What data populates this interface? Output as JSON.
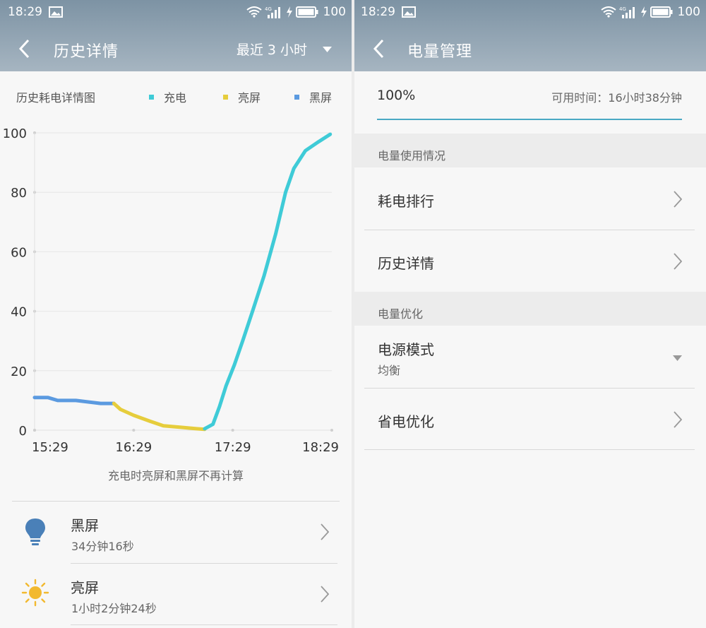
{
  "left": {
    "status": {
      "time": "18:29",
      "battery": "100"
    },
    "title": "历史详情",
    "range_selector": "最近 3 小时",
    "chart_title": "历史耗电详情图",
    "legend": [
      {
        "label": "充电",
        "color": "#3fcbd7"
      },
      {
        "label": "亮屏",
        "color": "#e6cd3c"
      },
      {
        "label": "黑屏",
        "color": "#5b9ae0"
      }
    ],
    "note": "充电时亮屏和黑屏不再计算",
    "usage": [
      {
        "title": "黑屏",
        "duration": "34分钟16秒",
        "icon": "bulb-off-icon"
      },
      {
        "title": "亮屏",
        "duration": "1小时2分钟24秒",
        "icon": "sun-icon"
      }
    ]
  },
  "right": {
    "status": {
      "time": "18:29",
      "battery": "100"
    },
    "title": "电量管理",
    "battery_percent": "100%",
    "available_time": "可用时间：16小时38分钟",
    "sections": [
      {
        "header": "电量使用情况",
        "items": [
          {
            "label": "耗电排行"
          },
          {
            "label": "历史详情"
          }
        ]
      },
      {
        "header": "电量优化",
        "items": [
          {
            "label": "电源模式",
            "value": "均衡"
          },
          {
            "label": "省电优化"
          }
        ]
      }
    ]
  },
  "chart_data": {
    "type": "line",
    "x_ticks": [
      "15:29",
      "16:29",
      "17:29",
      "18:29"
    ],
    "y_ticks": [
      0,
      20,
      40,
      60,
      80,
      100
    ],
    "ylim": [
      0,
      100
    ],
    "xlim": [
      0,
      180
    ],
    "grid": true,
    "series": [
      {
        "name": "黑屏",
        "color": "#5b9ae0",
        "points": [
          [
            0,
            11
          ],
          [
            2,
            11
          ],
          [
            4,
            11
          ],
          [
            8,
            11
          ],
          [
            14,
            10
          ],
          [
            25,
            10
          ],
          [
            40,
            9
          ],
          [
            48,
            9
          ]
        ]
      },
      {
        "name": "亮屏",
        "color": "#e6cd3c",
        "points": [
          [
            48,
            9
          ],
          [
            52,
            7
          ],
          [
            60,
            5
          ],
          [
            70,
            3
          ],
          [
            78,
            1.5
          ],
          [
            88,
            1
          ],
          [
            98,
            0.5
          ],
          [
            103,
            0.3
          ]
        ]
      },
      {
        "name": "充电",
        "color": "#3fcbd7",
        "points": [
          [
            103,
            0.5
          ],
          [
            108,
            2
          ],
          [
            112,
            8
          ],
          [
            116,
            15
          ],
          [
            121,
            22
          ],
          [
            126,
            30
          ],
          [
            132,
            40
          ],
          [
            139,
            52
          ],
          [
            146,
            66
          ],
          [
            152,
            80
          ],
          [
            157,
            88
          ],
          [
            164,
            94
          ],
          [
            172,
            97
          ],
          [
            179,
            99.5
          ]
        ]
      }
    ]
  }
}
